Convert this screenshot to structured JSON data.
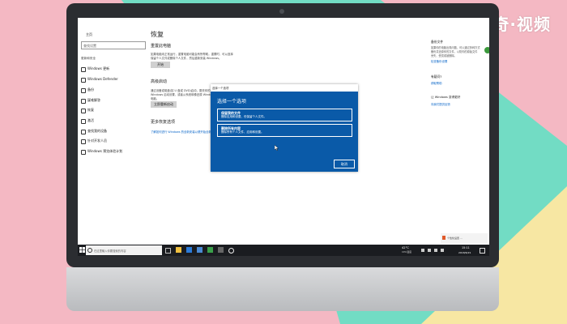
{
  "watermark": "天奇·视频",
  "settings": {
    "back_label": "主页",
    "find_setting": "查找设置",
    "category": "更新和安全",
    "sidebar": [
      {
        "label": "Windows 更新",
        "icon": "refresh-icon"
      },
      {
        "label": "Windows Defender",
        "icon": "shield-icon"
      },
      {
        "label": "备份",
        "icon": "upload-icon"
      },
      {
        "label": "疑难解答",
        "icon": "wrench-icon"
      },
      {
        "label": "恢复",
        "icon": "history-icon"
      },
      {
        "label": "激活",
        "icon": "check-circle-icon"
      },
      {
        "label": "查找我的设备",
        "icon": "person-pin-icon"
      },
      {
        "label": "针对开发人员",
        "icon": "dev-tools-icon"
      },
      {
        "label": "Windows 预览体验计划",
        "icon": "windows-insider-icon"
      }
    ],
    "page_title": "恢复",
    "reset_heading": "重置此电脑",
    "reset_desc_1": "如果电脑未正常运行，重置电脑可能会有所帮助。重置时，可以选择",
    "reset_desc_2": "保留个人文件或删除个人文件，然后重新安装 Windows。",
    "start_button": "开始",
    "advanced_heading": "高级启动",
    "advanced_desc_1": "通过设备或磁盘(如 U 盘或 DVD)启动，更改你的电脑固件设置，更改",
    "advanced_desc_2": "Windows 启动设置，或者从系统映像还原 Windows。这将重新启动",
    "advanced_desc_3": "电脑。",
    "restart_button": "立即重新启动",
    "more_heading": "更多恢复选项",
    "more_link": "了解如何进行 Windows 的全新安装以便开始全新的体验",
    "right_panel": {
      "backup_heading": "备份文件",
      "backup_desc_1": "如果你的电脑出现问题，可以通过多种方式",
      "backup_desc_2": "备份并还原你的文件，以防你的原始文件",
      "backup_desc_3": "丢失、受损或被删除。",
      "backup_link": "检查备份设置",
      "help_heading": "有疑问?",
      "help_link": "获取帮助",
      "improve_heading": "让 Windows 变得更好",
      "improve_link": "向我们提供反馈"
    }
  },
  "dialog": {
    "bar_title": "选择一个选项",
    "title": "选择一个选项",
    "option1_title": "保留我的文件",
    "option1_desc": "删除应用和设置，但保留个人文件。",
    "option2_title": "删除所有内容",
    "option2_desc": "删除所有个人文件、应用和设置。",
    "cancel": "取消"
  },
  "notification": {
    "line1": "个性化设置  ...",
    "line2": ""
  },
  "taskbar": {
    "search_placeholder": "在这里输入你要搜索的内容",
    "weather": "42°C",
    "weather_sub": "CPU温度",
    "time": "15:11",
    "date": "2018/6/21"
  },
  "colors": {
    "dialog_blue": "#0a5aa8",
    "link_blue": "#0a66c8",
    "taskbar": "#1a1c20"
  }
}
